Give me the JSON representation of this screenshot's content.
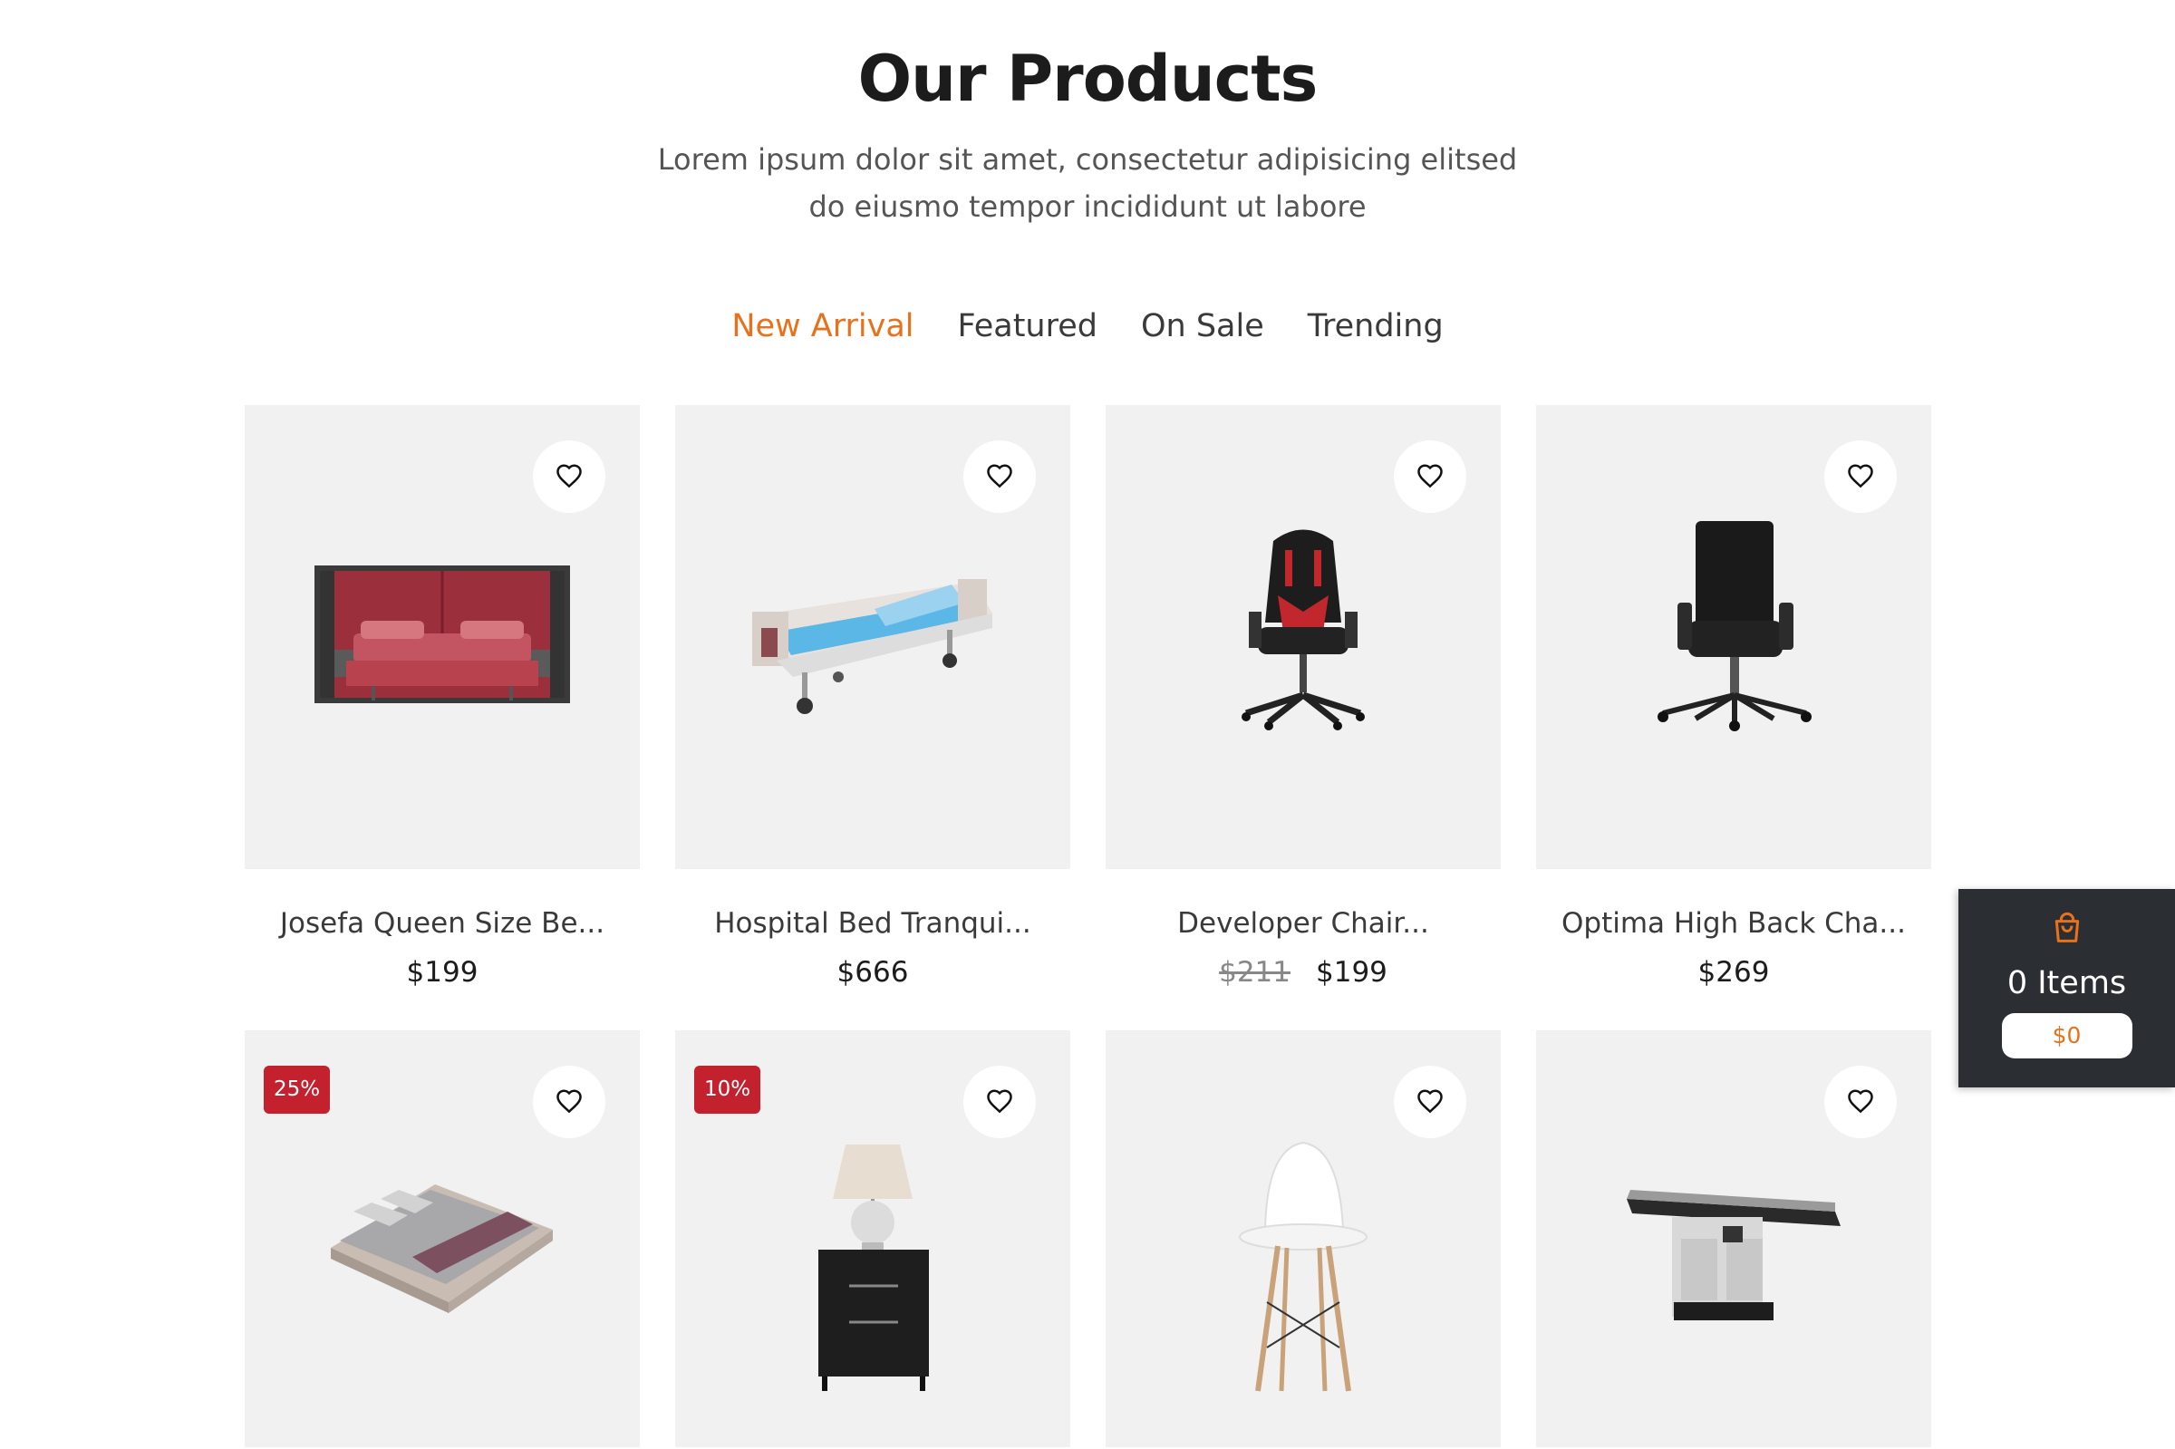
{
  "section": {
    "title": "Our Products",
    "subtitle": "Lorem ipsum dolor sit amet, consectetur adipisicing elitsed do eiusmo tempor incididunt ut labore"
  },
  "tabs": [
    {
      "label": "New Arrival",
      "active": true
    },
    {
      "label": "Featured",
      "active": false
    },
    {
      "label": "On Sale",
      "active": false
    },
    {
      "label": "Trending",
      "active": false
    }
  ],
  "products": [
    {
      "name": "Josefa Queen Size Be...",
      "price": "$199",
      "old_price": "",
      "badge": "",
      "image": "red-queen-bed"
    },
    {
      "name": "Hospital Bed Tranqui...",
      "price": "$666",
      "old_price": "",
      "badge": "",
      "image": "hospital-bed"
    },
    {
      "name": "Developer Chair...",
      "price": "$199",
      "old_price": "$211",
      "badge": "",
      "image": "gaming-chair"
    },
    {
      "name": "Optima High Back Cha...",
      "price": "$269",
      "old_price": "",
      "badge": "",
      "image": "office-chair"
    },
    {
      "name": "",
      "price": "",
      "old_price": "",
      "badge": "25%",
      "image": "grey-bed"
    },
    {
      "name": "",
      "price": "",
      "old_price": "",
      "badge": "10%",
      "image": "lamp-nightstand"
    },
    {
      "name": "",
      "price": "",
      "old_price": "",
      "badge": "",
      "image": "white-chair"
    },
    {
      "name": "",
      "price": "",
      "old_price": "",
      "badge": "",
      "image": "exam-table"
    }
  ],
  "cart": {
    "count_label": "0 Items",
    "total": "$0",
    "icon": "shopping-bag-icon"
  },
  "colors": {
    "accent": "#e8721c",
    "badge": "#c4212f",
    "card_bg": "#f1f1f1",
    "cart_bg": "#2b2f33"
  }
}
